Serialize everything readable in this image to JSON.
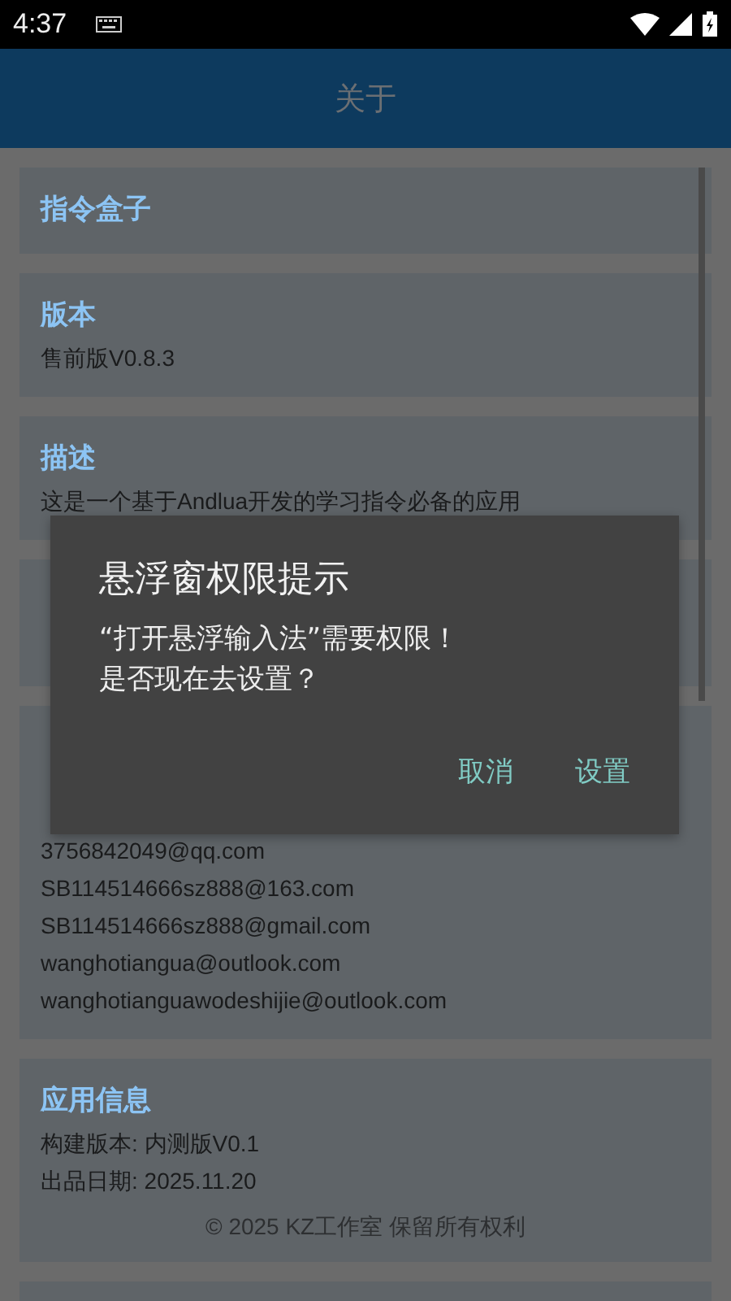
{
  "status_bar": {
    "time": "4:37"
  },
  "app_bar": {
    "title": "关于"
  },
  "cards": [
    {
      "kind": "plain",
      "title": "指令盒子"
    },
    {
      "kind": "plain",
      "title": "版本",
      "lines": [
        "售前版V0.8.3"
      ]
    },
    {
      "kind": "plain",
      "title": "描述",
      "lines": [
        "这是一个基于Andlua开发的学习指令必备的应用"
      ]
    },
    {
      "kind": "covered"
    },
    {
      "kind": "partly_covered",
      "lines": [
        "3756842049@qq.com",
        "SB114514666sz888@163.com",
        "SB114514666sz888@gmail.com",
        "wanghotiangua@outlook.com",
        "wanghotianguawodeshijie@outlook.com"
      ]
    },
    {
      "kind": "plain",
      "title": "应用信息",
      "lines": [
        "构建版本: 内测版V0.1",
        "出品日期: 2025.11.20"
      ],
      "footer": "© 2025 KZ工作室 保留所有权利"
    }
  ],
  "dialog": {
    "title": "悬浮窗权限提示",
    "message": [
      "“打开悬浮输入法”需要权限！",
      "是否现在去设置？"
    ],
    "buttons": [
      "取消",
      "设置"
    ]
  }
}
